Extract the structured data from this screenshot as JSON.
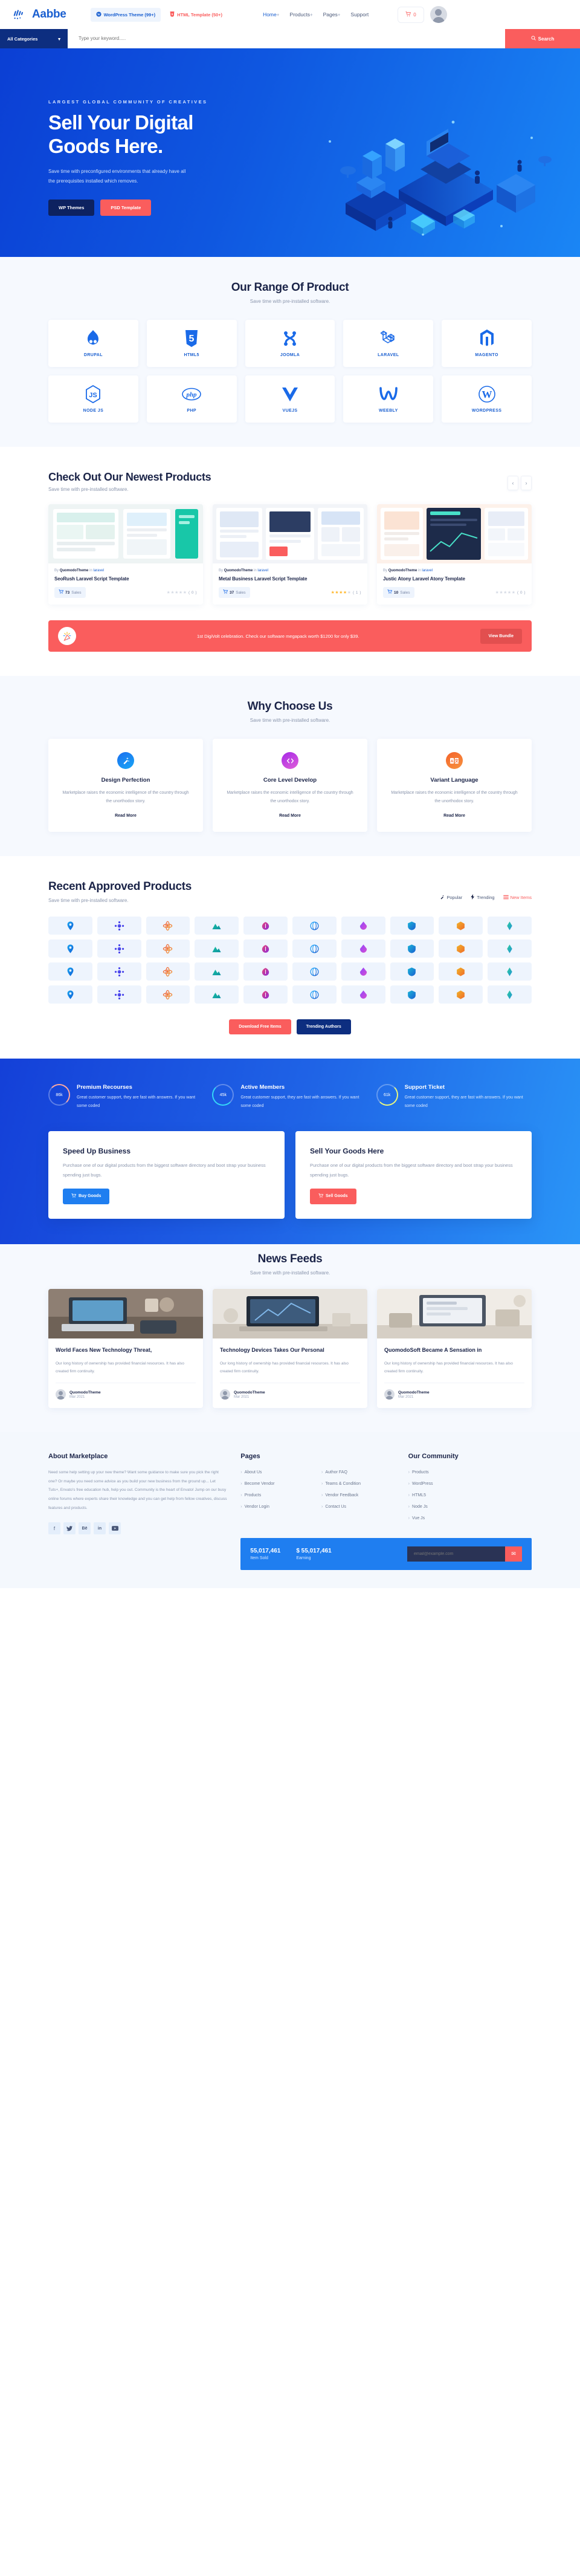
{
  "header": {
    "brand": "Aabbe",
    "pill_wp": "WordPress Theme (99+)",
    "pill_html": "HTML Template (50+)",
    "nav": [
      {
        "label": "Home",
        "plus": "+",
        "active": true
      },
      {
        "label": "Products",
        "plus": "+",
        "active": false
      },
      {
        "label": "Pages",
        "plus": "+",
        "active": false
      },
      {
        "label": "Support",
        "plus": "",
        "active": false
      }
    ],
    "cart_count": "0"
  },
  "search": {
    "category": "All Categories",
    "placeholder": "Type your keyword.....",
    "button": "Search"
  },
  "hero": {
    "eyebrow": "LARGEST GLOBAL COMMUNITY OF CREATIVES",
    "title_line1": "Sell Your Digital",
    "title_line2": "Goods Here.",
    "subtitle": "Save time with preconfigured environments that already have all the prerequisites installed which removes.",
    "btn_primary": "WP Themes",
    "btn_secondary": "PSD Template"
  },
  "range": {
    "title": "Our Range Of Product",
    "subtitle": "Save time with pre-installed software.",
    "items": [
      {
        "name": "DRUPAL",
        "icon": "drupal-icon"
      },
      {
        "name": "HTML5",
        "icon": "html5-icon"
      },
      {
        "name": "JOOMLA",
        "icon": "joomla-icon"
      },
      {
        "name": "LARAVEL",
        "icon": "laravel-icon"
      },
      {
        "name": "MAGENTO",
        "icon": "magento-icon"
      },
      {
        "name": "NODE JS",
        "icon": "nodejs-icon"
      },
      {
        "name": "PHP",
        "icon": "php-icon"
      },
      {
        "name": "VUEJS",
        "icon": "vuejs-icon"
      },
      {
        "name": "WEEBLY",
        "icon": "weebly-icon"
      },
      {
        "name": "WORDPRESS",
        "icon": "wordpress-icon"
      }
    ]
  },
  "newest": {
    "title": "Check Out Our Newest Products",
    "subtitle": "Save time with pre-installed software.",
    "prev_icon": "chevron-left-icon",
    "next_icon": "chevron-right-icon",
    "products": [
      {
        "by_prefix": "By",
        "author": "QuomodoTheme",
        "in_word": "in",
        "category": "laravel",
        "name": "SeoRush Laravel Script Template",
        "sales": "73",
        "sales_label": "Sales",
        "rating": 0,
        "rating_count": "( 0 )"
      },
      {
        "by_prefix": "By",
        "author": "QuomodoTheme",
        "in_word": "in",
        "category": "laravel",
        "name": "Metal Business Laravel Script Template",
        "sales": "37",
        "sales_label": "Sales",
        "rating": 4,
        "rating_count": "( 1 )"
      },
      {
        "by_prefix": "By",
        "author": "QuomodoTheme",
        "in_word": "in",
        "category": "laravel",
        "name": "Justic Atony Laravel Atony Template",
        "sales": "10",
        "sales_label": "Sales",
        "rating": 0,
        "rating_count": "( 0 )"
      }
    ]
  },
  "promo": {
    "icon": "celebration-icon",
    "text": "1st DigiVolt celebration. Check our software megapack worth $1200 for only $39.",
    "button": "View Bundle"
  },
  "why": {
    "title": "Why Choose Us",
    "subtitle": "Save time with pre-installed software.",
    "cards": [
      {
        "icon": "magic-wand-icon",
        "color_a": "#1b6ff0",
        "color_b": "#18a6f5",
        "title": "Design Perfection",
        "text": "Marketplace raises the economic intelligence of the country through the unorthodox story.",
        "link": "Read More"
      },
      {
        "icon": "code-icon",
        "color_a": "#a528e8",
        "color_b": "#e060d8",
        "title": "Core Level Develop",
        "text": "Marketplace raises the economic intelligence of the country through the unorthodox story.",
        "link": "Read More"
      },
      {
        "icon": "translate-icon",
        "color_a": "#f4622a",
        "color_b": "#f79340",
        "title": "Variant Language",
        "text": "Marketplace raises the economic intelligence of the country through the unorthodox story.",
        "link": "Read More"
      }
    ]
  },
  "recent": {
    "title": "Recent Approved Products",
    "subtitle": "Save time with pre-installed software.",
    "tabs": [
      {
        "label": "Popular",
        "icon": "magic-wand-icon",
        "active": false
      },
      {
        "label": "Trending",
        "icon": "bolt-icon",
        "active": false
      },
      {
        "label": "New Items",
        "icon": "list-icon",
        "active": true
      }
    ],
    "icon_tiles": [
      "pin-icon",
      "gear-icon",
      "atom-icon",
      "mountain-icon",
      "leaf-icon",
      "globe-icon",
      "droplet-icon",
      "shield-icon",
      "hexagon-icon",
      "diamond-icon",
      "shape-icon",
      "circles-icon",
      "spiral-icon",
      "burst-icon",
      "cube-icon",
      "rings-icon",
      "flag-icon",
      "arrow-icon",
      "star-icon",
      "wave-icon",
      "flower-icon",
      "bloom-icon",
      "orbit-icon",
      "ribbon-icon",
      "target-icon",
      "prism-icon",
      "ball-icon",
      "drop-icon",
      "wing-icon",
      "loop-icon",
      "crescent-icon",
      "pulse-icon",
      "swirl-icon",
      "key-icon",
      "plant-icon",
      "tree-icon",
      "chat-icon",
      "badge-icon",
      "book-icon",
      "coin-icon"
    ],
    "btn_red": "Download Free Items",
    "btn_navy": "Trending Authors"
  },
  "stats": {
    "items": [
      {
        "value": "86k",
        "ring_color": "#fda8a0",
        "title": "Premium Recourses",
        "text": "Great customer support, they are fast with answers. If you want some coded"
      },
      {
        "value": "45k",
        "ring_color": "#35d6f7",
        "title": "Active Members",
        "text": "Great customer support, they are fast with answers. If you want some coded"
      },
      {
        "value": "61k",
        "ring_color": "#e9f77f",
        "title": "Support Ticket",
        "text": "Great customer support, they are fast with answers. If you want some coded"
      }
    ],
    "cta": [
      {
        "title": "Speed Up Business",
        "text": "Purchase one of our digital products from the biggest software directory and boot strap your business spending just bugs.",
        "button": "Buy Goods",
        "button_color": "#1f7ef0",
        "icon": "cart-icon"
      },
      {
        "title": "Sell Your Goods Here",
        "text": "Purchase one of our digital products from the biggest software directory and boot strap your business spending just bugs.",
        "button": "Sell Goods",
        "button_color": "#fa5d5d",
        "icon": "cart-icon"
      }
    ]
  },
  "news": {
    "title": "News Feeds",
    "subtitle": "Save time with pre-installed software.",
    "posts": [
      {
        "title": "World Faces New Technology Threat,",
        "text": "Our long history of ownership has provided financial resources. It has also created firm continuity.",
        "author": "QuomodoTheme",
        "date": "Mar 2021"
      },
      {
        "title": "Technology Devices Takes Our Personal",
        "text": "Our long history of ownership has provided financial resources. It has also created firm continuity.",
        "author": "QuomodoTheme",
        "date": "Mar 2021"
      },
      {
        "title": "QuomodoSoft Became A Sensation in",
        "text": "Our long history of ownership has provided financial resources. It has also created firm continuity.",
        "author": "QuomodoTheme",
        "date": "Mar 2021"
      }
    ]
  },
  "footer": {
    "about_title": "About Marketplace",
    "about_text": "Need some help setting up your new theme? Want some guidance to make sure you pick the right one? Or maybe you need some advice as you build your new business from the ground up... Let Tuts+, Envato's free education hub, help you out. Community is the heart of Envato! Jump on our busy online forums where experts share their knowledge and you can get help from fellow creatives, discuss features and products.",
    "socials": [
      "facebook-icon",
      "twitter-icon",
      "behance-icon",
      "linkedin-icon",
      "youtube-icon"
    ],
    "social_glyphs": [
      "f",
      "✈",
      "Bē",
      "in",
      "▶"
    ],
    "pages_title": "Pages",
    "pages_links": [
      "About Us",
      "Author FAQ",
      "Become Vendor",
      "Teams & Condition",
      "Products",
      "Vendor Feedback",
      "Vendor Login",
      "Contact Us"
    ],
    "community_title": "Our Community",
    "community_links": [
      "Products",
      "WordPress",
      "HTML5",
      "Node Js",
      "Vue Js"
    ],
    "stat_items_sold_value": "55,017,461",
    "stat_items_sold_label": "Item Sold",
    "stat_earning_value": "$ 55,017,461",
    "stat_earning_label": "Earning",
    "newsletter_placeholder": "email@example.com",
    "newsletter_icon": "envelope-icon"
  }
}
